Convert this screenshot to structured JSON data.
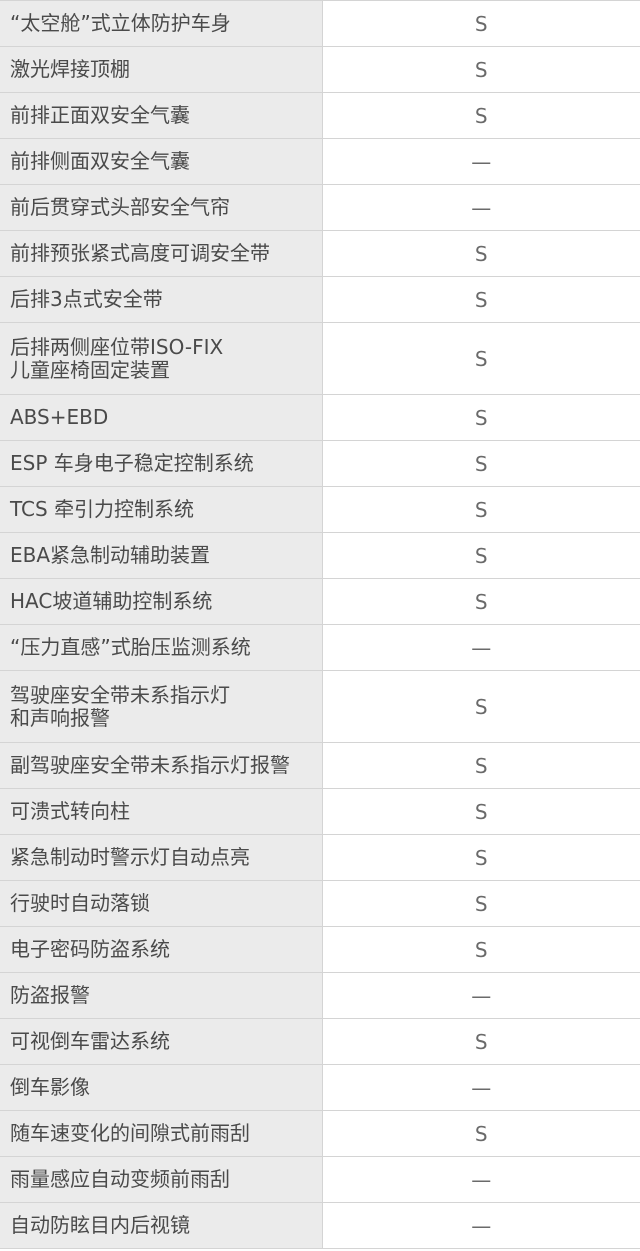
{
  "spec_table": {
    "rows": [
      {
        "feature": "“太空舱”式立体防护车身",
        "value": "S"
      },
      {
        "feature": "激光焊接顶棚",
        "value": "S"
      },
      {
        "feature": "前排正面双安全气囊",
        "value": "S"
      },
      {
        "feature": "前排侧面双安全气囊",
        "value": "—"
      },
      {
        "feature": "前后贯穿式头部安全气帘",
        "value": "—"
      },
      {
        "feature": "前排预张紧式高度可调安全带",
        "value": "S"
      },
      {
        "feature": "后排3点式安全带",
        "value": "S"
      },
      {
        "feature": "后排两侧座位带ISO-FIX\n儿童座椅固定装置",
        "value": "S"
      },
      {
        "feature": "ABS+EBD",
        "value": "S"
      },
      {
        "feature": "ESP 车身电子稳定控制系统",
        "value": "S"
      },
      {
        "feature": "TCS 牵引力控制系统",
        "value": "S"
      },
      {
        "feature": "EBA紧急制动辅助装置",
        "value": "S"
      },
      {
        "feature": "HAC坡道辅助控制系统",
        "value": "S"
      },
      {
        "feature": "“压力直感”式胎压监测系统",
        "value": "—"
      },
      {
        "feature": "驾驶座安全带未系指示灯\n和声响报警",
        "value": "S"
      },
      {
        "feature": "副驾驶座安全带未系指示灯报警",
        "value": "S"
      },
      {
        "feature": "可溃式转向柱",
        "value": "S"
      },
      {
        "feature": "紧急制动时警示灯自动点亮",
        "value": "S"
      },
      {
        "feature": "行驶时自动落锁",
        "value": "S"
      },
      {
        "feature": "电子密码防盗系统",
        "value": "S"
      },
      {
        "feature": "防盗报警",
        "value": "—"
      },
      {
        "feature": "可视倒车雷达系统",
        "value": "S"
      },
      {
        "feature": "倒车影像",
        "value": "—"
      },
      {
        "feature": "随车速变化的间隙式前雨刮",
        "value": "S"
      },
      {
        "feature": "雨量感应自动变频前雨刮",
        "value": "—"
      },
      {
        "feature": "自动防眩目内后视镜",
        "value": "—"
      }
    ]
  }
}
